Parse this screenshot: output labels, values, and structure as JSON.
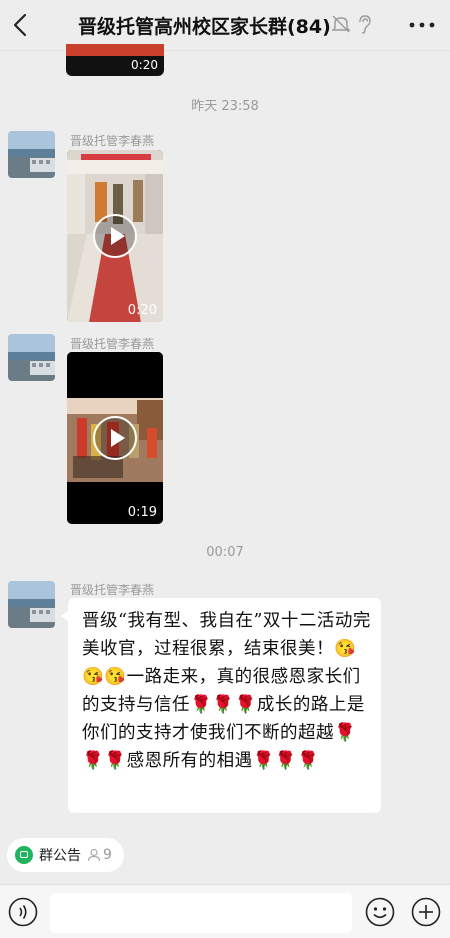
{
  "header": {
    "title": "晋级托管高州校区家长群(84)",
    "icons": [
      "back-icon",
      "mute-bell-icon",
      "ear-icon",
      "more-icon"
    ]
  },
  "messages": {
    "top_video": {
      "duration": "0:20"
    },
    "timestamp_1": "昨天 23:58",
    "video_1": {
      "sender": "晋级托管李春燕",
      "duration": "0:20"
    },
    "video_2": {
      "sender": "晋级托管李春燕",
      "duration": "0:19"
    },
    "timestamp_2": "00:07",
    "text_msg": {
      "sender": "晋级托管李春燕",
      "part1": "晋级“我有型、我自在”双十二活动完美收官，过程很累，结束很美！",
      "emoji1": "😘😘😘",
      "part2": "一路走来，真的很感恩家长们的支持与信任",
      "roses1": "🌹🌹🌹",
      "part3": "成长的路上是你们的支持才使我们不断的超越",
      "roses2": "🌹🌹🌹",
      "part4": "感恩所有的相遇",
      "roses3": "🌹🌹🌹"
    }
  },
  "group_notice": {
    "label": "群公告",
    "count": "9"
  },
  "input_bar": {
    "placeholder": ""
  }
}
